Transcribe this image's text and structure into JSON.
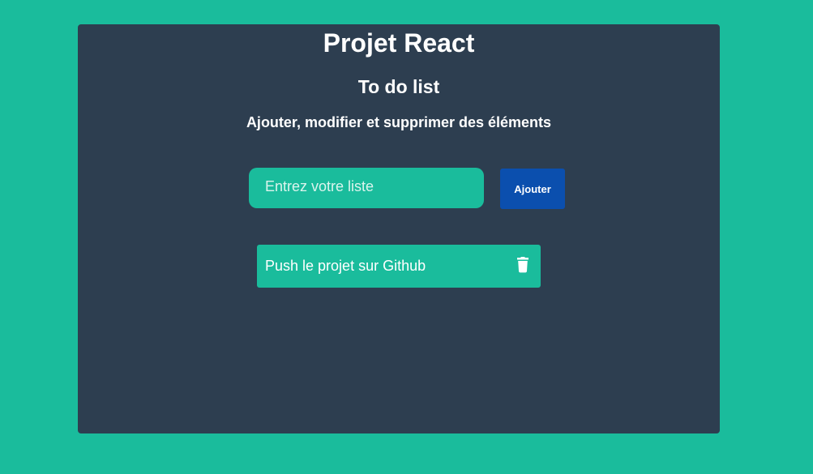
{
  "header": {
    "title": "Projet React",
    "subtitle": "To do list",
    "description": "Ajouter, modifier et supprimer des éléments"
  },
  "form": {
    "input_value": "",
    "input_placeholder": "Entrez votre liste",
    "add_button_label": "Ajouter"
  },
  "todos": [
    {
      "text": "Push le projet sur Github",
      "delete_icon": "trash-icon"
    }
  ],
  "colors": {
    "page_background": "#1abc9c",
    "card_background": "#2d3e50",
    "accent": "#1abc9c",
    "button": "#0b4fae",
    "text": "#ffffff"
  }
}
